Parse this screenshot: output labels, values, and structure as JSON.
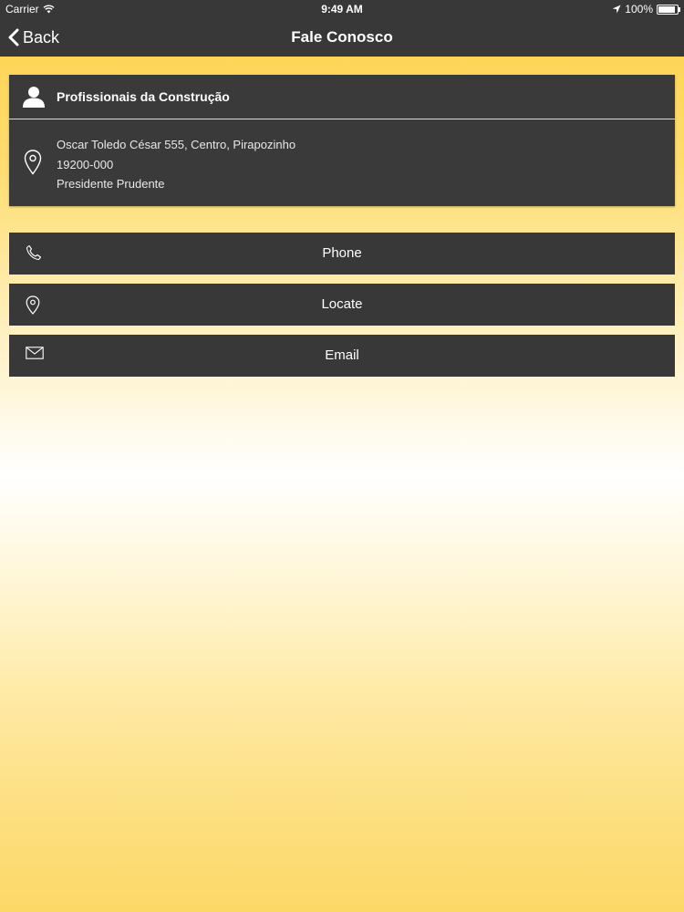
{
  "status_bar": {
    "carrier": "Carrier",
    "time": "9:49 AM",
    "battery": "100%",
    "battery_level": 1.0
  },
  "nav": {
    "back_label": "Back",
    "title": "Fale Conosco"
  },
  "contact": {
    "name": "Profissionais da Construção",
    "address_lines": [
      "Oscar Toledo César 555, Centro, Pirapozinho",
      "19200-000",
      "Presidente Prudente"
    ]
  },
  "actions": [
    {
      "label": "Phone",
      "icon": "phone-icon"
    },
    {
      "label": "Locate",
      "icon": "location-pin-icon"
    },
    {
      "label": "Email",
      "icon": "envelope-icon"
    }
  ],
  "colors": {
    "bar": "#383838",
    "card": "#3a3a3a",
    "background_gold": "#fdd24c",
    "text": "#ffffff"
  }
}
